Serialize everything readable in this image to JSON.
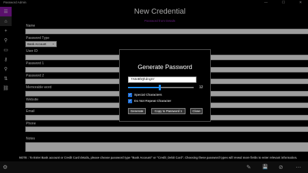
{
  "window": {
    "title": "Password Admin",
    "minimize_glyph": "—",
    "maximize_glyph": "☐",
    "close_glyph": "✕"
  },
  "sidebar": {
    "items": [
      {
        "icon": "hamburger-menu-icon",
        "glyph": "☰"
      },
      {
        "icon": "home-icon",
        "glyph": "⌂"
      },
      {
        "icon": "add-icon",
        "glyph": "+"
      },
      {
        "icon": "key-search-icon",
        "glyph": "⚲"
      },
      {
        "icon": "credit-card-icon",
        "glyph": "▭"
      },
      {
        "icon": "key-icon",
        "glyph": "⚷"
      },
      {
        "icon": "pin-icon",
        "glyph": "⚲"
      },
      {
        "icon": "sort-icon",
        "glyph": "⇅"
      },
      {
        "icon": "link-icon",
        "glyph": "⛓"
      },
      {
        "icon": "settings-icon",
        "glyph": "⚙"
      }
    ]
  },
  "header": {
    "title": "New Credential"
  },
  "form": {
    "top_link": "Password from Details",
    "fields": {
      "name": "Name",
      "password_type": "Password Type",
      "password_type_value": "Bank Account",
      "user_id": "User ID",
      "password1": "Password 1",
      "password2": "Password 2",
      "memorable_word": "Memorable word",
      "website": "Website",
      "email": "Email",
      "phone": "Phone",
      "notes": "Notes"
    },
    "note": "NOTE : To Enter Bank account or Credit Card details, please choose password type \"Bank Account\" or \"Credit_Debit Card\". Choosing these password types will reveal more fields to enter relevant information."
  },
  "dialog": {
    "title": "Generate Password",
    "generated_password": "7A6eBhQhdngXr",
    "length_value": "12",
    "length_fraction": 0.48,
    "special_characters": "Special Characters",
    "special_checked": true,
    "no_repeat": "Do Not Repeat Character",
    "no_repeat_checked": true,
    "buttons": {
      "generate": "Generate",
      "copy": "Copy to Password 1",
      "close": "Close"
    }
  },
  "bottombar": {
    "icons": [
      "settings-icon",
      "edit-icon",
      "save-icon",
      "cancel-icon",
      "more-icon"
    ],
    "glyphs": [
      "⚙",
      "✎",
      "💾",
      "⊘",
      "⋯"
    ]
  },
  "colors": {
    "accent_purple": "#8b1aa6",
    "checkbox_blue": "#1e6fd9",
    "slider_blue": "#1e90ff"
  }
}
